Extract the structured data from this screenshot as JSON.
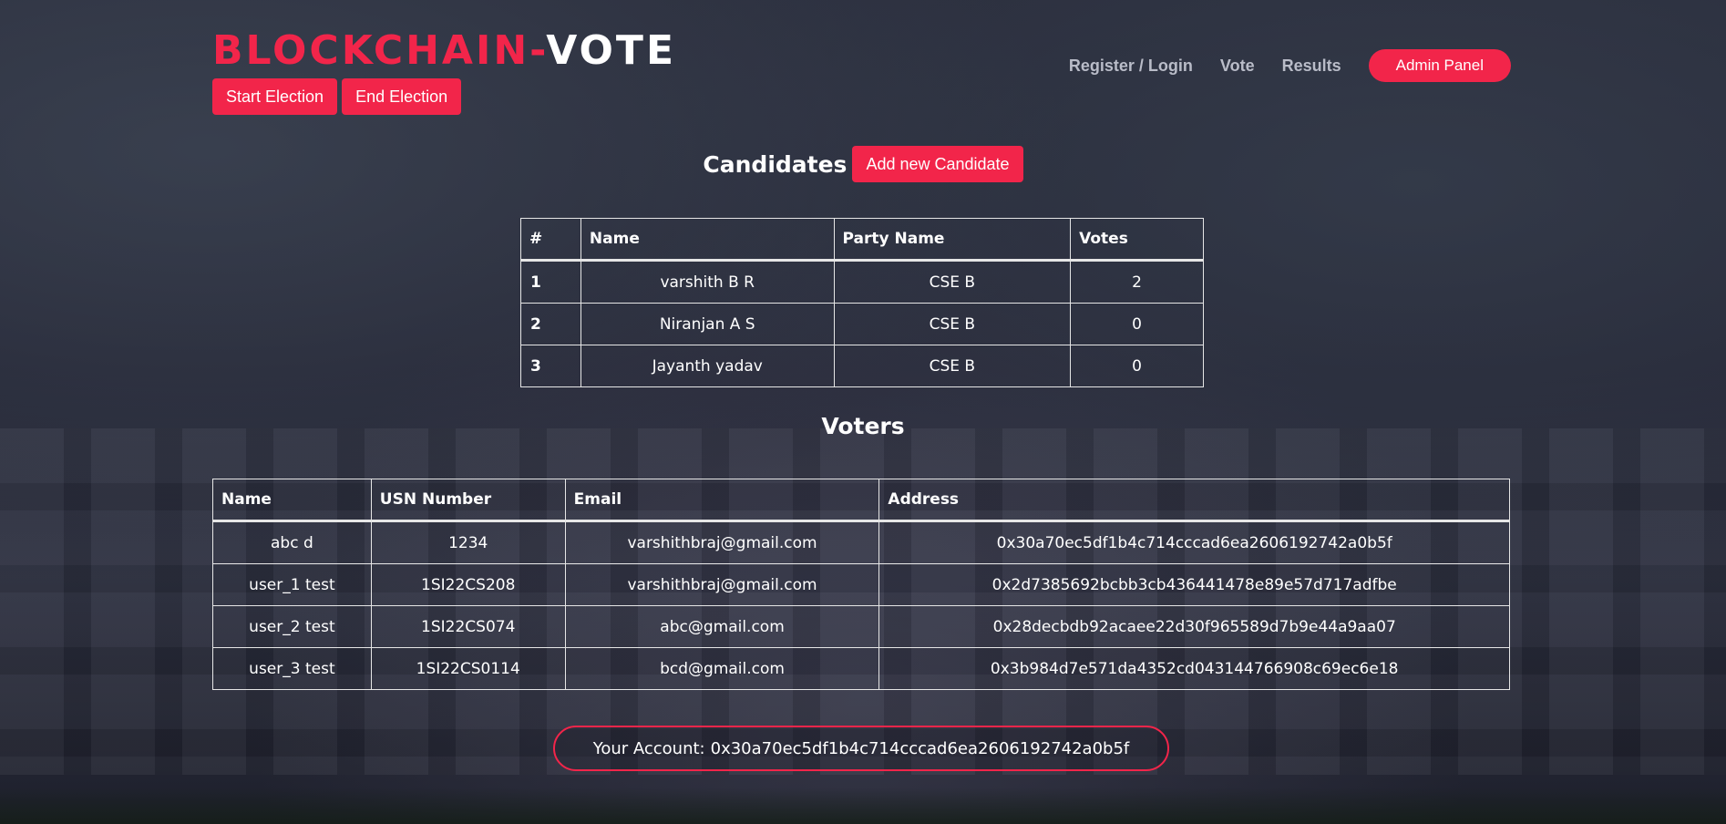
{
  "brand": {
    "accent": "BLOCKCHAIN-",
    "rest": "VOTE"
  },
  "election": {
    "start_label": "Start Election",
    "end_label": "End Election"
  },
  "nav": {
    "register_login": "Register / Login",
    "vote": "Vote",
    "results": "Results",
    "admin_panel": "Admin Panel"
  },
  "candidates": {
    "title": "Candidates",
    "add_button": "Add new Candidate",
    "headers": [
      "#",
      "Name",
      "Party Name",
      "Votes"
    ],
    "rows": [
      {
        "id": "1",
        "name": "varshith B R",
        "party": "CSE B",
        "votes": "2"
      },
      {
        "id": "2",
        "name": "Niranjan A S",
        "party": "CSE B",
        "votes": "0"
      },
      {
        "id": "3",
        "name": "Jayanth yadav",
        "party": "CSE B",
        "votes": "0"
      }
    ]
  },
  "voters": {
    "title": "Voters",
    "headers": [
      "Name",
      "USN Number",
      "Email",
      "Address"
    ],
    "rows": [
      {
        "name": "abc d",
        "usn": "1234",
        "email": "varshithbraj@gmail.com",
        "address": "0x30a70ec5df1b4c714cccad6ea2606192742a0b5f"
      },
      {
        "name": "user_1 test",
        "usn": "1SI22CS208",
        "email": "varshithbraj@gmail.com",
        "address": "0x2d7385692bcbb3cb436441478e89e57d717adfbe"
      },
      {
        "name": "user_2 test",
        "usn": "1SI22CS074",
        "email": "abc@gmail.com",
        "address": "0x28decbdb92acaee22d30f965589d7b9e44a9aa07"
      },
      {
        "name": "user_3 test",
        "usn": "1SI22CS0114",
        "email": "bcd@gmail.com",
        "address": "0x3b984d7e571da4352cd043144766908c69ec6e18"
      }
    ]
  },
  "account": {
    "label": "Your Account:",
    "address": "0x30a70ec5df1b4c714cccad6ea2606192742a0b5f"
  },
  "colors": {
    "accent": "#f2254a",
    "nav_text": "#b9bcc8",
    "background": "#2a2d3c"
  }
}
